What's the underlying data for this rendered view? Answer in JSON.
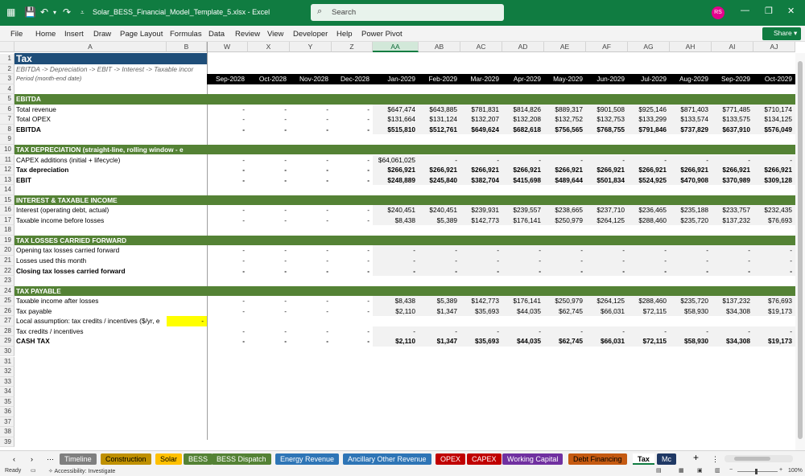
{
  "titlebar": {
    "filename": "Solar_BESS_Financial_Model_Template_5.xlsx",
    "app": "Excel",
    "search_placeholder": "Search",
    "avatar_initials": "RS"
  },
  "menu": [
    "File",
    "Home",
    "Insert",
    "Draw",
    "Page Layout",
    "Formulas",
    "Data",
    "Review",
    "View",
    "Developer",
    "Help",
    "Power Pivot"
  ],
  "share_label": "Share",
  "columns": [
    "A",
    "B",
    "W",
    "X",
    "Y",
    "Z",
    "AA",
    "AB",
    "AC",
    "AD",
    "AE",
    "AF",
    "AG",
    "AH",
    "AI",
    "AJ"
  ],
  "selected_column": "AA",
  "rows": [
    {
      "n": "1",
      "label": "Tax",
      "type": "title"
    },
    {
      "n": "2",
      "label": "EBITDA -> Depreciation -> EBIT -> Interest -> Taxable incor",
      "type": "subtitle"
    },
    {
      "n": "3",
      "label": "Period (month-end date)",
      "type": "period",
      "values": [
        "Sep-2028",
        "Oct-2028",
        "Nov-2028",
        "Dec-2028",
        "Jan-2029",
        "Feb-2029",
        "Mar-2029",
        "Apr-2029",
        "May-2029",
        "Jun-2029",
        "Jul-2029",
        "Aug-2029",
        "Sep-2029",
        "Oct-2029"
      ]
    },
    {
      "n": "4",
      "label": "",
      "type": "blank"
    },
    {
      "n": "5",
      "label": "EBITDA",
      "type": "section"
    },
    {
      "n": "6",
      "label": "Total revenue",
      "type": "data",
      "values": [
        "-",
        "-",
        "-",
        "-",
        "$647,474",
        "$643,885",
        "$781,831",
        "$814,826",
        "$889,317",
        "$901,508",
        "$925,146",
        "$871,403",
        "$771,485",
        "$710,174"
      ]
    },
    {
      "n": "7",
      "label": "Total OPEX",
      "type": "data",
      "values": [
        "-",
        "-",
        "-",
        "-",
        "$131,664",
        "$131,124",
        "$132,207",
        "$132,208",
        "$132,752",
        "$132,753",
        "$133,299",
        "$133,574",
        "$133,575",
        "$134,125"
      ]
    },
    {
      "n": "8",
      "label": "EBITDA",
      "type": "bolddata",
      "values": [
        "-",
        "-",
        "-",
        "-",
        "$515,810",
        "$512,761",
        "$649,624",
        "$682,618",
        "$756,565",
        "$768,755",
        "$791,846",
        "$737,829",
        "$637,910",
        "$576,049"
      ]
    },
    {
      "n": "9",
      "label": "",
      "type": "blank"
    },
    {
      "n": "10",
      "label": "TAX DEPRECIATION (straight-line, rolling window - e",
      "type": "section"
    },
    {
      "n": "11",
      "label": "CAPEX additions (initial + lifecycle)",
      "type": "data",
      "values": [
        "-",
        "-",
        "-",
        "-",
        "$64,061,025",
        "-",
        "-",
        "-",
        "-",
        "-",
        "-",
        "-",
        "-",
        "-"
      ]
    },
    {
      "n": "12",
      "label": "Tax depreciation",
      "type": "bolddata",
      "values": [
        "-",
        "-",
        "-",
        "-",
        "$266,921",
        "$266,921",
        "$266,921",
        "$266,921",
        "$266,921",
        "$266,921",
        "$266,921",
        "$266,921",
        "$266,921",
        "$266,921"
      ]
    },
    {
      "n": "13",
      "label": "EBIT",
      "type": "bolddata",
      "values": [
        "-",
        "-",
        "-",
        "-",
        "$248,889",
        "$245,840",
        "$382,704",
        "$415,698",
        "$489,644",
        "$501,834",
        "$524,925",
        "$470,908",
        "$370,989",
        "$309,128"
      ]
    },
    {
      "n": "14",
      "label": "",
      "type": "blank"
    },
    {
      "n": "15",
      "label": "INTEREST & TAXABLE INCOME",
      "type": "section"
    },
    {
      "n": "16",
      "label": "Interest (operating debt, actual)",
      "type": "data",
      "values": [
        "-",
        "-",
        "-",
        "-",
        "$240,451",
        "$240,451",
        "$239,931",
        "$239,557",
        "$238,665",
        "$237,710",
        "$236,465",
        "$235,188",
        "$233,757",
        "$232,435"
      ]
    },
    {
      "n": "17",
      "label": "Taxable income before losses",
      "type": "data",
      "values": [
        "-",
        "-",
        "-",
        "-",
        "$8,438",
        "$5,389",
        "$142,773",
        "$176,141",
        "$250,979",
        "$264,125",
        "$288,460",
        "$235,720",
        "$137,232",
        "$76,693"
      ]
    },
    {
      "n": "18",
      "label": "",
      "type": "blank"
    },
    {
      "n": "19",
      "label": "TAX LOSSES CARRIED FORWARD",
      "type": "section"
    },
    {
      "n": "20",
      "label": "Opening tax losses carried forward",
      "type": "data",
      "values": [
        "-",
        "-",
        "-",
        "-",
        "-",
        "-",
        "-",
        "-",
        "-",
        "-",
        "-",
        "-",
        "-",
        "-"
      ]
    },
    {
      "n": "21",
      "label": "Losses used this month",
      "type": "data",
      "values": [
        "-",
        "-",
        "-",
        "-",
        "-",
        "-",
        "-",
        "-",
        "-",
        "-",
        "-",
        "-",
        "-",
        "-"
      ]
    },
    {
      "n": "22",
      "label": "Closing tax losses carried forward",
      "type": "bolddata",
      "values": [
        "-",
        "-",
        "-",
        "-",
        "-",
        "-",
        "-",
        "-",
        "-",
        "-",
        "-",
        "-",
        "-",
        "-"
      ]
    },
    {
      "n": "23",
      "label": "",
      "type": "blank"
    },
    {
      "n": "24",
      "label": "TAX PAYABLE",
      "type": "section"
    },
    {
      "n": "25",
      "label": "Taxable income after losses",
      "type": "data",
      "values": [
        "-",
        "-",
        "-",
        "-",
        "$8,438",
        "$5,389",
        "$142,773",
        "$176,141",
        "$250,979",
        "$264,125",
        "$288,460",
        "$235,720",
        "$137,232",
        "$76,693"
      ]
    },
    {
      "n": "26",
      "label": "Tax payable",
      "type": "data",
      "values": [
        "-",
        "-",
        "-",
        "-",
        "$2,110",
        "$1,347",
        "$35,693",
        "$44,035",
        "$62,745",
        "$66,031",
        "$72,115",
        "$58,930",
        "$34,308",
        "$19,173"
      ]
    },
    {
      "n": "27",
      "label": "Local assumption: tax credits / incentives ($/yr, e",
      "type": "input",
      "bval": "-"
    },
    {
      "n": "28",
      "label": "Tax credits / incentives",
      "type": "data",
      "values": [
        "-",
        "-",
        "-",
        "-",
        "-",
        "-",
        "-",
        "-",
        "-",
        "-",
        "-",
        "-",
        "-",
        "-"
      ]
    },
    {
      "n": "29",
      "label": "CASH TAX",
      "type": "bolddata",
      "values": [
        "-",
        "-",
        "-",
        "-",
        "$2,110",
        "$1,347",
        "$35,693",
        "$44,035",
        "$62,745",
        "$66,031",
        "$72,115",
        "$58,930",
        "$34,308",
        "$19,173"
      ]
    },
    {
      "n": "30",
      "label": "",
      "type": "empty"
    },
    {
      "n": "31",
      "label": "",
      "type": "empty"
    },
    {
      "n": "32",
      "label": "",
      "type": "empty"
    },
    {
      "n": "33",
      "label": "",
      "type": "empty"
    },
    {
      "n": "34",
      "label": "",
      "type": "empty"
    },
    {
      "n": "35",
      "label": "",
      "type": "empty"
    },
    {
      "n": "36",
      "label": "",
      "type": "empty"
    },
    {
      "n": "37",
      "label": "",
      "type": "empty"
    },
    {
      "n": "38",
      "label": "",
      "type": "empty"
    },
    {
      "n": "39",
      "label": "",
      "type": "empty"
    }
  ],
  "sheet_tabs": [
    {
      "label": "Timeline",
      "bg": "#7f7f7f",
      "fg": "#ffffff"
    },
    {
      "label": "Construction",
      "bg": "#bf9000",
      "fg": "#000000"
    },
    {
      "label": "Solar",
      "bg": "#ffc000",
      "fg": "#000000"
    },
    {
      "label": "BESS",
      "bg": "#548235",
      "fg": "#ffffff"
    },
    {
      "label": "BESS Dispatch",
      "bg": "#548235",
      "fg": "#ffffff"
    },
    {
      "label": "Energy Revenue",
      "bg": "#2e75b6",
      "fg": "#ffffff"
    },
    {
      "label": "Ancillary Other Revenue",
      "bg": "#2e75b6",
      "fg": "#ffffff"
    },
    {
      "label": "OPEX",
      "bg": "#c00000",
      "fg": "#ffffff"
    },
    {
      "label": "CAPEX",
      "bg": "#c00000",
      "fg": "#ffffff"
    },
    {
      "label": "Working Capital",
      "bg": "#7030a0",
      "fg": "#ffffff"
    },
    {
      "label": "Debt Financing",
      "bg": "#c55a11",
      "fg": "#000000"
    },
    {
      "label": "Tax",
      "bg": "#ffffff",
      "fg": "#000000",
      "active": true
    },
    {
      "label": "Mc",
      "bg": "#1f3864",
      "fg": "#ffffff"
    }
  ],
  "status": {
    "ready": "Ready",
    "accessibility": "Accessibility: Investigate",
    "zoom": "100%"
  }
}
